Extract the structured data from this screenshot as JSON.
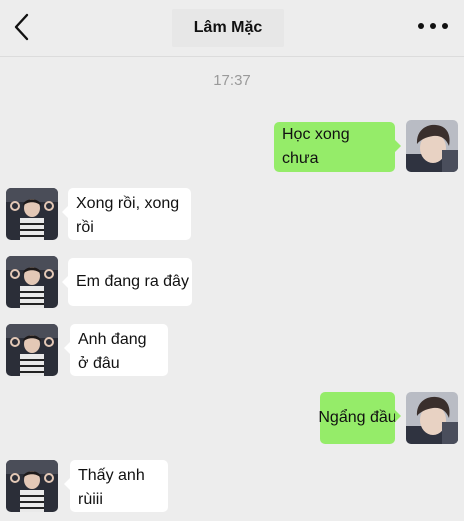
{
  "header": {
    "title": "Lâm Mặc",
    "back_icon": "chevron-left-icon",
    "more_icon": "more-dots-icon"
  },
  "timestamp": "17:37",
  "colors": {
    "background": "#ededed",
    "outgoing_bubble": "#95ec69",
    "incoming_bubble": "#ffffff"
  },
  "messages": [
    {
      "direction": "outgoing",
      "text": "Học xong chưa"
    },
    {
      "direction": "incoming",
      "text": "Xong rồi, xong rồi"
    },
    {
      "direction": "incoming",
      "text": "Em đang ra đây"
    },
    {
      "direction": "incoming",
      "text": "Anh đang ở đâu"
    },
    {
      "direction": "outgoing",
      "text": "Ngẩng đầu"
    },
    {
      "direction": "incoming",
      "text": "Thấy anh rùiii"
    }
  ]
}
